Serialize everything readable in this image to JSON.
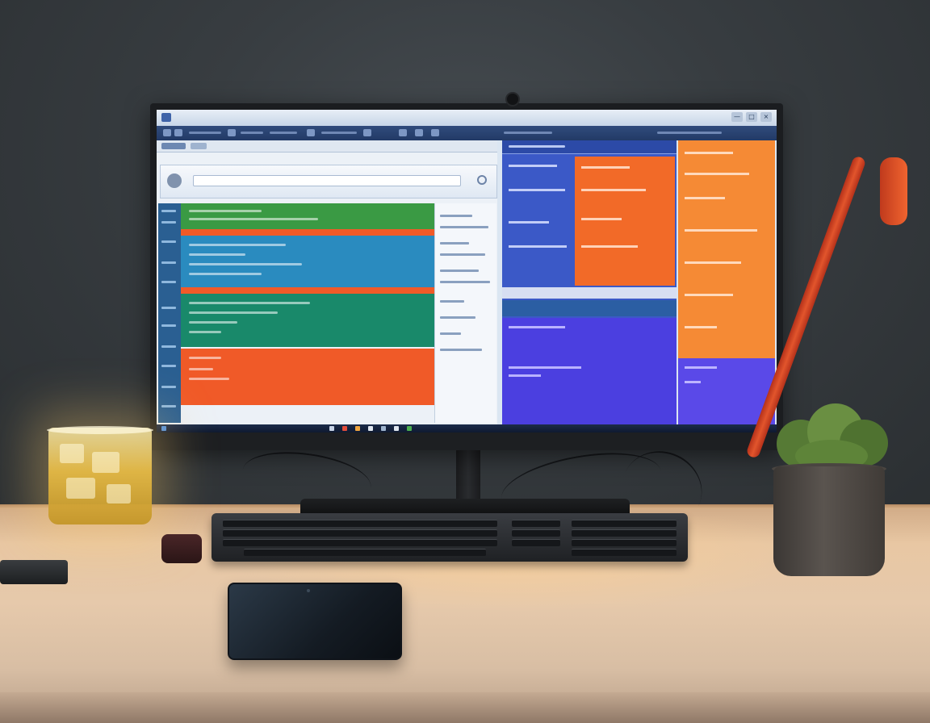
{
  "scene": "desk-workspace",
  "screen": {
    "title": "",
    "window_controls": [
      "—",
      "□",
      "×"
    ]
  },
  "colors": {
    "wall": "#383d41",
    "desk": "#e6c9ab",
    "band_green": "#3a9a44",
    "band_orange": "#f05a28",
    "band_blue": "#2a8bbf",
    "band_teal": "#19896a",
    "panel_blue": "#3b59c7",
    "panel_orange": "#f26a28",
    "panel_indigo": "#4b3fe0"
  }
}
